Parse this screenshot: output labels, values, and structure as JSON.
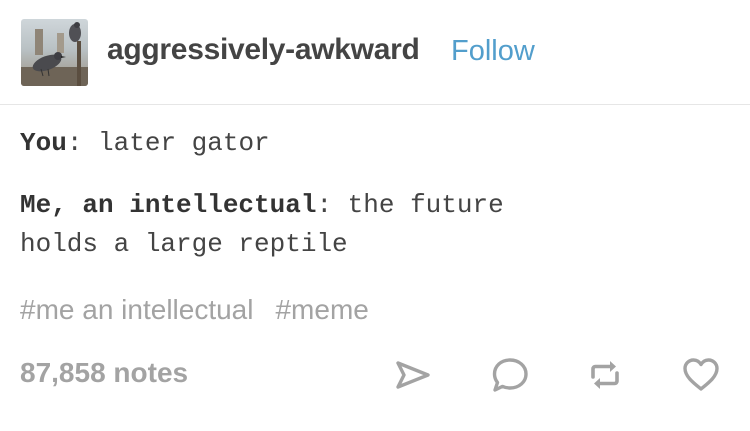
{
  "post": {
    "blog_name": "aggressively-awkward",
    "follow_label": "Follow",
    "dialogue": [
      {
        "speaker": "You",
        "separator": ": ",
        "text": "later gator"
      },
      {
        "speaker": "Me, an intellectual",
        "separator": ": ",
        "text": "the future",
        "continuation": "holds a large reptile"
      }
    ],
    "tags": [
      "#me an intellectual",
      "#meme"
    ],
    "notes": "87,858 notes"
  },
  "icons": {
    "avatar": "pigeon-photo",
    "actions": [
      "share-icon",
      "reply-icon",
      "reblog-icon",
      "like-icon"
    ]
  },
  "colors": {
    "follow": "#529ecc",
    "text": "#444444",
    "muted": "#a3a3a3"
  }
}
